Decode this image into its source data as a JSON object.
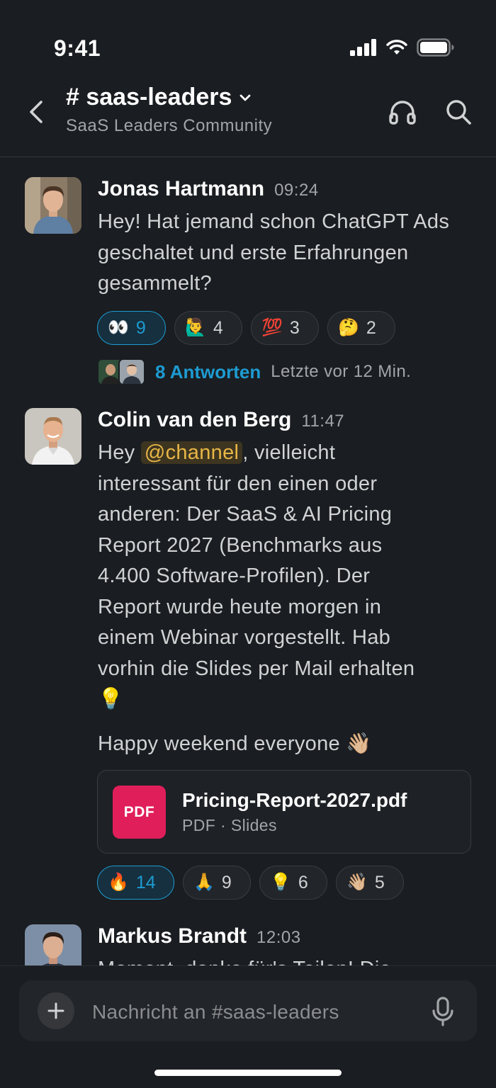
{
  "status_bar": {
    "time": "9:41"
  },
  "header": {
    "channel": "# saas-leaders",
    "subtitle": "SaaS Leaders Community"
  },
  "messages": [
    {
      "author": "Jonas Hartmann",
      "time": "09:24",
      "text": "Hey! Hat jemand schon ChatGPT Ads geschaltet und erste Erfahrungen gesammelt?",
      "reactions": [
        {
          "emoji": "👀",
          "count": "9",
          "active": true
        },
        {
          "emoji": "🙋‍♂️",
          "count": "4",
          "active": false
        },
        {
          "emoji": "💯",
          "count": "3",
          "active": false
        },
        {
          "emoji": "🤔",
          "count": "2",
          "active": false
        }
      ],
      "thread": {
        "replies": "8 Antworten",
        "last": "Letzte vor 12 Min."
      }
    },
    {
      "author": "Colin van den Berg",
      "time": "11:47",
      "text_before_mention": "Hey ",
      "mention": "@channel",
      "text_after_mention": ", vielleicht interessant für den einen oder anderen: Der SaaS & AI Pricing Report 2027 (Benchmarks aus 4.400 Software-Profilen). Der Report wurde heute morgen in einem Webinar vorgestellt. Hab vorhin die Slides per Mail erhalten 💡",
      "text2": "Happy weekend everyone 👋🏼",
      "attachment": {
        "type_label": "PDF",
        "name": "Pricing-Report-2027.pdf",
        "meta": "PDF · Slides"
      },
      "reactions": [
        {
          "emoji": "🔥",
          "count": "14",
          "active": true
        },
        {
          "emoji": "🙏",
          "count": "9",
          "active": false
        },
        {
          "emoji": "💡",
          "count": "6",
          "active": false
        },
        {
          "emoji": "👋🏼",
          "count": "5",
          "active": false
        }
      ]
    },
    {
      "author": "Markus Brandt",
      "time": "12:03",
      "text": "Moment, danke für's Teilen! Die"
    }
  ],
  "composer": {
    "placeholder": "Nachricht an #saas-leaders"
  },
  "colors": {
    "background": "#1a1d21",
    "link": "#1d9bd1",
    "mention_bg": "#3d3520",
    "mention_fg": "#e8b647",
    "pdf": "#e01e5a"
  }
}
